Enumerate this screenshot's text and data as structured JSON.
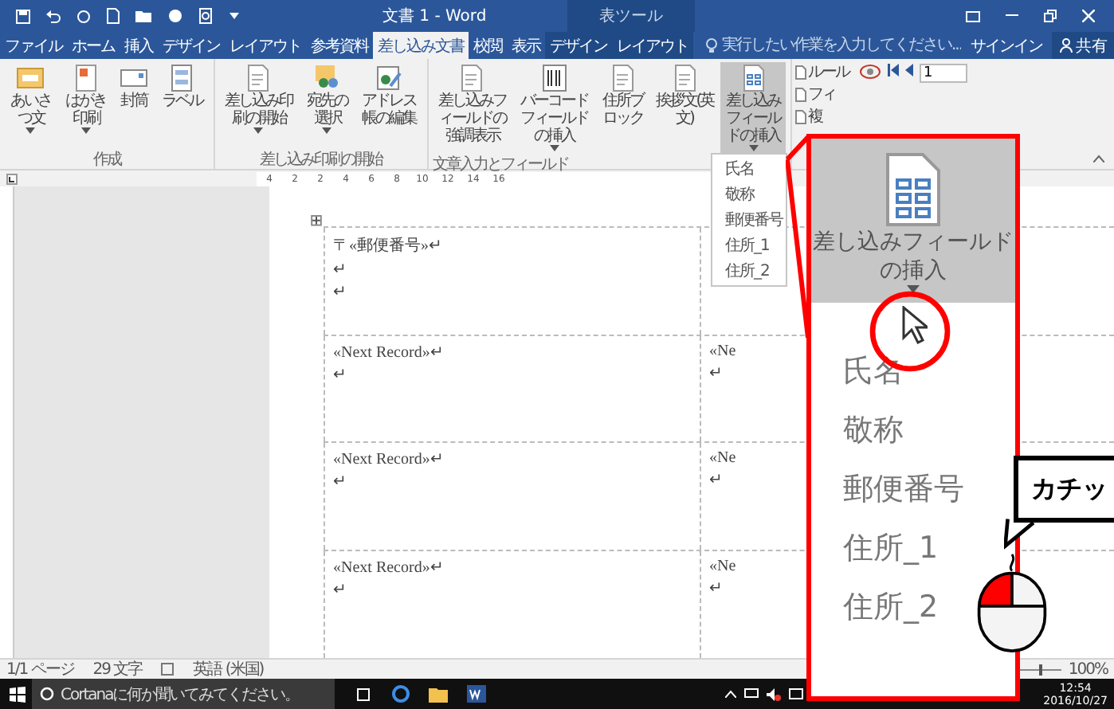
{
  "title_bar": {
    "title": "文書 1 - Word",
    "context_header": "表ツール"
  },
  "tabs": [
    {
      "label": "ファイル",
      "selected": false,
      "kind": "file"
    },
    {
      "label": "ホーム",
      "selected": false,
      "kind": "main"
    },
    {
      "label": "挿入",
      "selected": false,
      "kind": "main"
    },
    {
      "label": "デザイン",
      "selected": false,
      "kind": "main"
    },
    {
      "label": "レイアウト",
      "selected": false,
      "kind": "main"
    },
    {
      "label": "参考資料",
      "selected": false,
      "kind": "main"
    },
    {
      "label": "差し込み文書",
      "selected": true,
      "kind": "main"
    },
    {
      "label": "校閲",
      "selected": false,
      "kind": "main"
    },
    {
      "label": "表示",
      "selected": false,
      "kind": "main"
    },
    {
      "label": "デザイン",
      "selected": false,
      "kind": "context"
    },
    {
      "label": "レイアウト",
      "selected": false,
      "kind": "context"
    }
  ],
  "tell_me": {
    "placeholder": "実行したい作業を入力してください..."
  },
  "account": {
    "sign_in": "サインイン",
    "share": "共有"
  },
  "ribbon": {
    "groups": [
      {
        "label": "作成",
        "buttons": [
          {
            "label": "あいさつ文",
            "kind": "card",
            "dropdown": true,
            "highlighted": false
          },
          {
            "label": "はがき印刷",
            "kind": "postcard",
            "dropdown": true,
            "highlighted": false
          },
          {
            "label": "封筒",
            "kind": "envelope",
            "dropdown": false,
            "highlighted": false
          },
          {
            "label": "ラベル",
            "kind": "label",
            "dropdown": false,
            "highlighted": false
          }
        ]
      },
      {
        "label": "差し込み印刷の開始",
        "buttons": [
          {
            "label": "差し込み印刷の開始",
            "kind": "doc",
            "dropdown": true,
            "highlighted": false
          },
          {
            "label": "宛先の選択",
            "kind": "people",
            "dropdown": true,
            "highlighted": false
          },
          {
            "label": "アドレス帳の編集",
            "kind": "edit",
            "dropdown": false,
            "highlighted": false
          }
        ]
      },
      {
        "label": "文章入力とフィールド",
        "buttons": [
          {
            "label": "差し込みフィールドの強調表示",
            "kind": "doc",
            "dropdown": false,
            "highlighted": false
          },
          {
            "label": "バーコードフィールドの挿入",
            "kind": "barcode",
            "dropdown": true,
            "highlighted": false
          },
          {
            "label": "住所ブロック",
            "kind": "doc",
            "dropdown": false,
            "highlighted": false
          },
          {
            "label": "挨拶文(英文)",
            "kind": "doc",
            "dropdown": false,
            "highlighted": false
          },
          {
            "label": "差し込みフィールドの挿入",
            "kind": "grid",
            "dropdown": true,
            "highlighted": true
          }
        ]
      }
    ],
    "small_buttons": [
      "ルール",
      "フィ",
      "複"
    ],
    "record": "1"
  },
  "ruler": {
    "numbers": [
      "4",
      "2",
      "2",
      "4",
      "6",
      "8",
      "10",
      "12",
      "14",
      "16"
    ]
  },
  "field_menu": {
    "items": [
      "氏名",
      "敬称",
      "郵便番号",
      "住所_1",
      "住所_2"
    ]
  },
  "table": {
    "rows": [
      {
        "column_1": [
          "〒«郵便番号»↵",
          "↵",
          "↵"
        ]
      },
      {
        "column_1": [
          "«Next Record»↵",
          "↵"
        ],
        "column_2": [
          "«Ne",
          "↵"
        ]
      },
      {
        "column_1": [
          "«Next Record»↵",
          "↵"
        ],
        "column_2": [
          "«Ne",
          "↵"
        ]
      },
      {
        "column_1": [
          "«Next Record»↵",
          "↵"
        ],
        "column_2": [
          "«Ne",
          "↵"
        ]
      }
    ]
  },
  "status_bar": {
    "page": "1/1 ページ",
    "words": "29 文字",
    "language": "英語 (米国)",
    "zoom": "100%",
    "zoom_slider": {
      "level": 0.5
    }
  },
  "taskbar": {
    "search_placeholder": "Cortanaに何か聞いてみてください。",
    "time": "12:54",
    "date": "2016/10/27"
  },
  "callout": {
    "button_label": "差し込みフィールドの挿入",
    "items": [
      "氏名",
      "敬称",
      "郵便番号",
      "住所_1",
      "住所_2"
    ],
    "bubble_text": "カチッ"
  }
}
